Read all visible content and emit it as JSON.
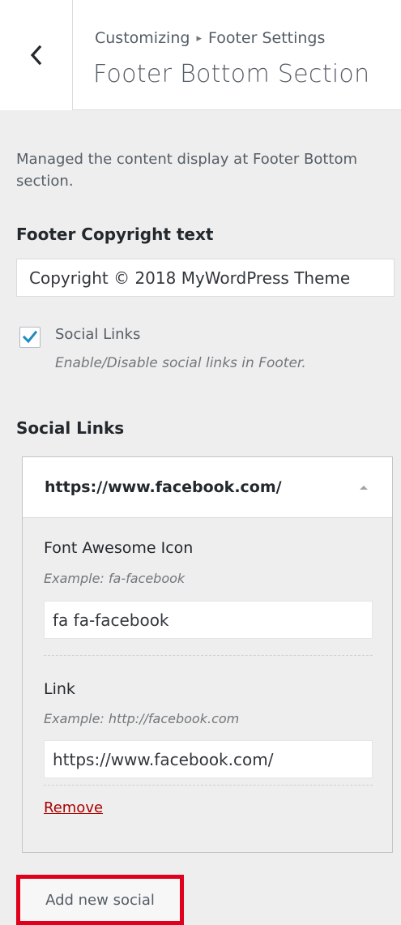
{
  "header": {
    "breadcrumb_parent": "Customizing",
    "breadcrumb_separator": "▸",
    "breadcrumb_current": "Footer Settings",
    "title": "Footer Bottom Section"
  },
  "section": {
    "description": "Managed the content display at Footer Bottom section."
  },
  "copyright": {
    "label": "Footer Copyright text",
    "value": "Copyright © 2018 MyWordPress Theme"
  },
  "social_toggle": {
    "checked": true,
    "label": "Social Links",
    "description": "Enable/Disable social links in Footer."
  },
  "social_links": {
    "label": "Social Links",
    "items": [
      {
        "title": "https://www.facebook.com/",
        "icon_label": "Font Awesome Icon",
        "icon_example": "Example: fa-facebook",
        "icon_value": "fa fa-facebook",
        "link_label": "Link",
        "link_example": "Example: http://facebook.com",
        "link_value": "https://www.facebook.com/",
        "remove_label": "Remove"
      }
    ],
    "add_label": "Add new social"
  },
  "colors": {
    "accent": "#0073aa",
    "remove": "#aa0000",
    "highlight": "#e0001b"
  },
  "icons": {
    "back": "chevron-left-icon",
    "check": "checkmark-icon",
    "collapse": "triangle-up-icon"
  }
}
